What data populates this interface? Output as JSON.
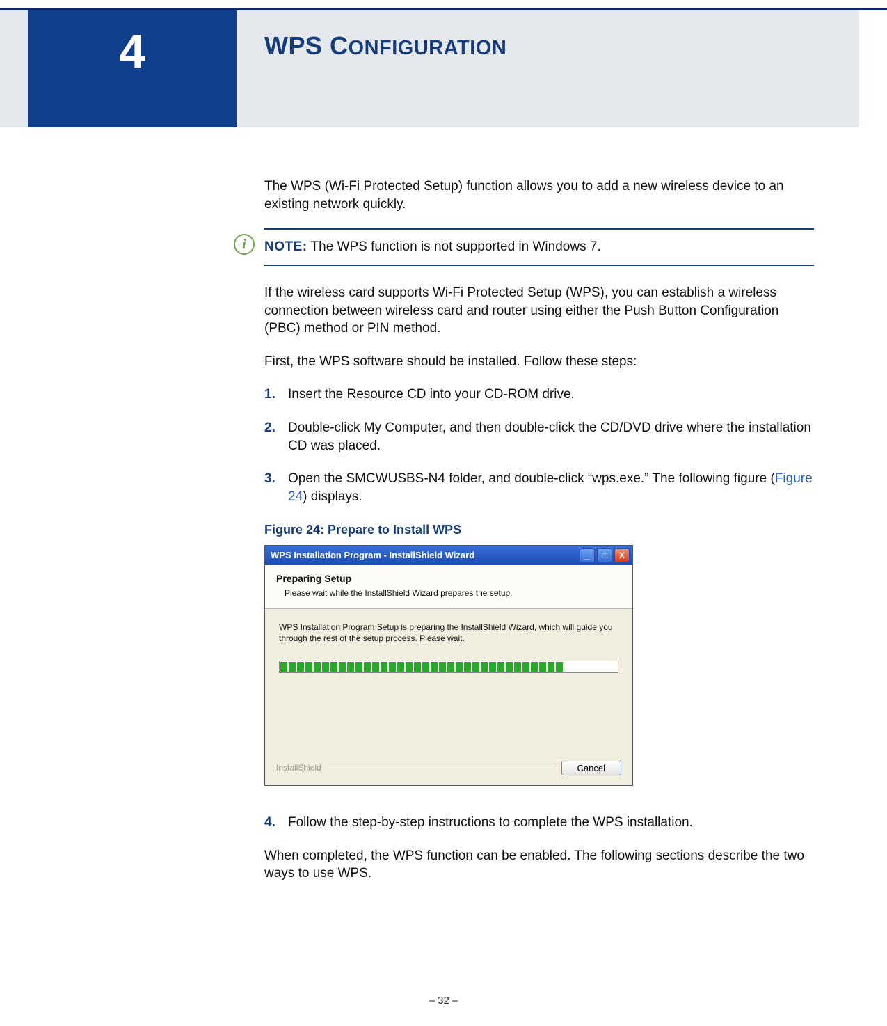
{
  "chapter": {
    "number": "4",
    "title_main": "WPS C",
    "title_rest": "ONFIGURATION"
  },
  "intro": "The WPS (Wi-Fi Protected Setup) function allows you to add a new wireless device to an existing network quickly.",
  "note": {
    "label": "NOTE:",
    "text": " The WPS function is not supported in Windows 7."
  },
  "para2": "If the wireless card supports Wi-Fi Protected Setup (WPS), you can establish a wireless connection between wireless card and router using either the Push Button Configuration (PBC) method or PIN method.",
  "para3": "First, the WPS software should be installed. Follow these steps:",
  "steps": {
    "s1": {
      "num": "1.",
      "text": "Insert the Resource CD into your CD-ROM drive."
    },
    "s2": {
      "num": "2.",
      "text": "Double-click My Computer, and then double-click the CD/DVD drive where the installation CD was placed."
    },
    "s3": {
      "num": "3.",
      "pre": "Open the SMCWUSBS-N4 folder, and double-click “wps.exe.” The following figure (",
      "link": "Figure 24",
      "post": ") displays."
    },
    "s4": {
      "num": "4.",
      "text": "Follow the step-by-step instructions to complete the WPS installation."
    }
  },
  "figure": {
    "caption": "Figure 24:  Prepare to Install WPS"
  },
  "dialog": {
    "title": "WPS Installation Program - InstallShield Wizard",
    "head1": "Preparing Setup",
    "head2": "Please wait while the InstallShield Wizard prepares the setup.",
    "body": "WPS Installation Program Setup is preparing the InstallShield Wizard, which will guide you through the rest of the setup process. Please wait.",
    "brand": "InstallShield",
    "cancel": "Cancel"
  },
  "closing": "When completed, the WPS function can be enabled. The following sections describe the two ways to use WPS.",
  "footer": "–  32  –"
}
